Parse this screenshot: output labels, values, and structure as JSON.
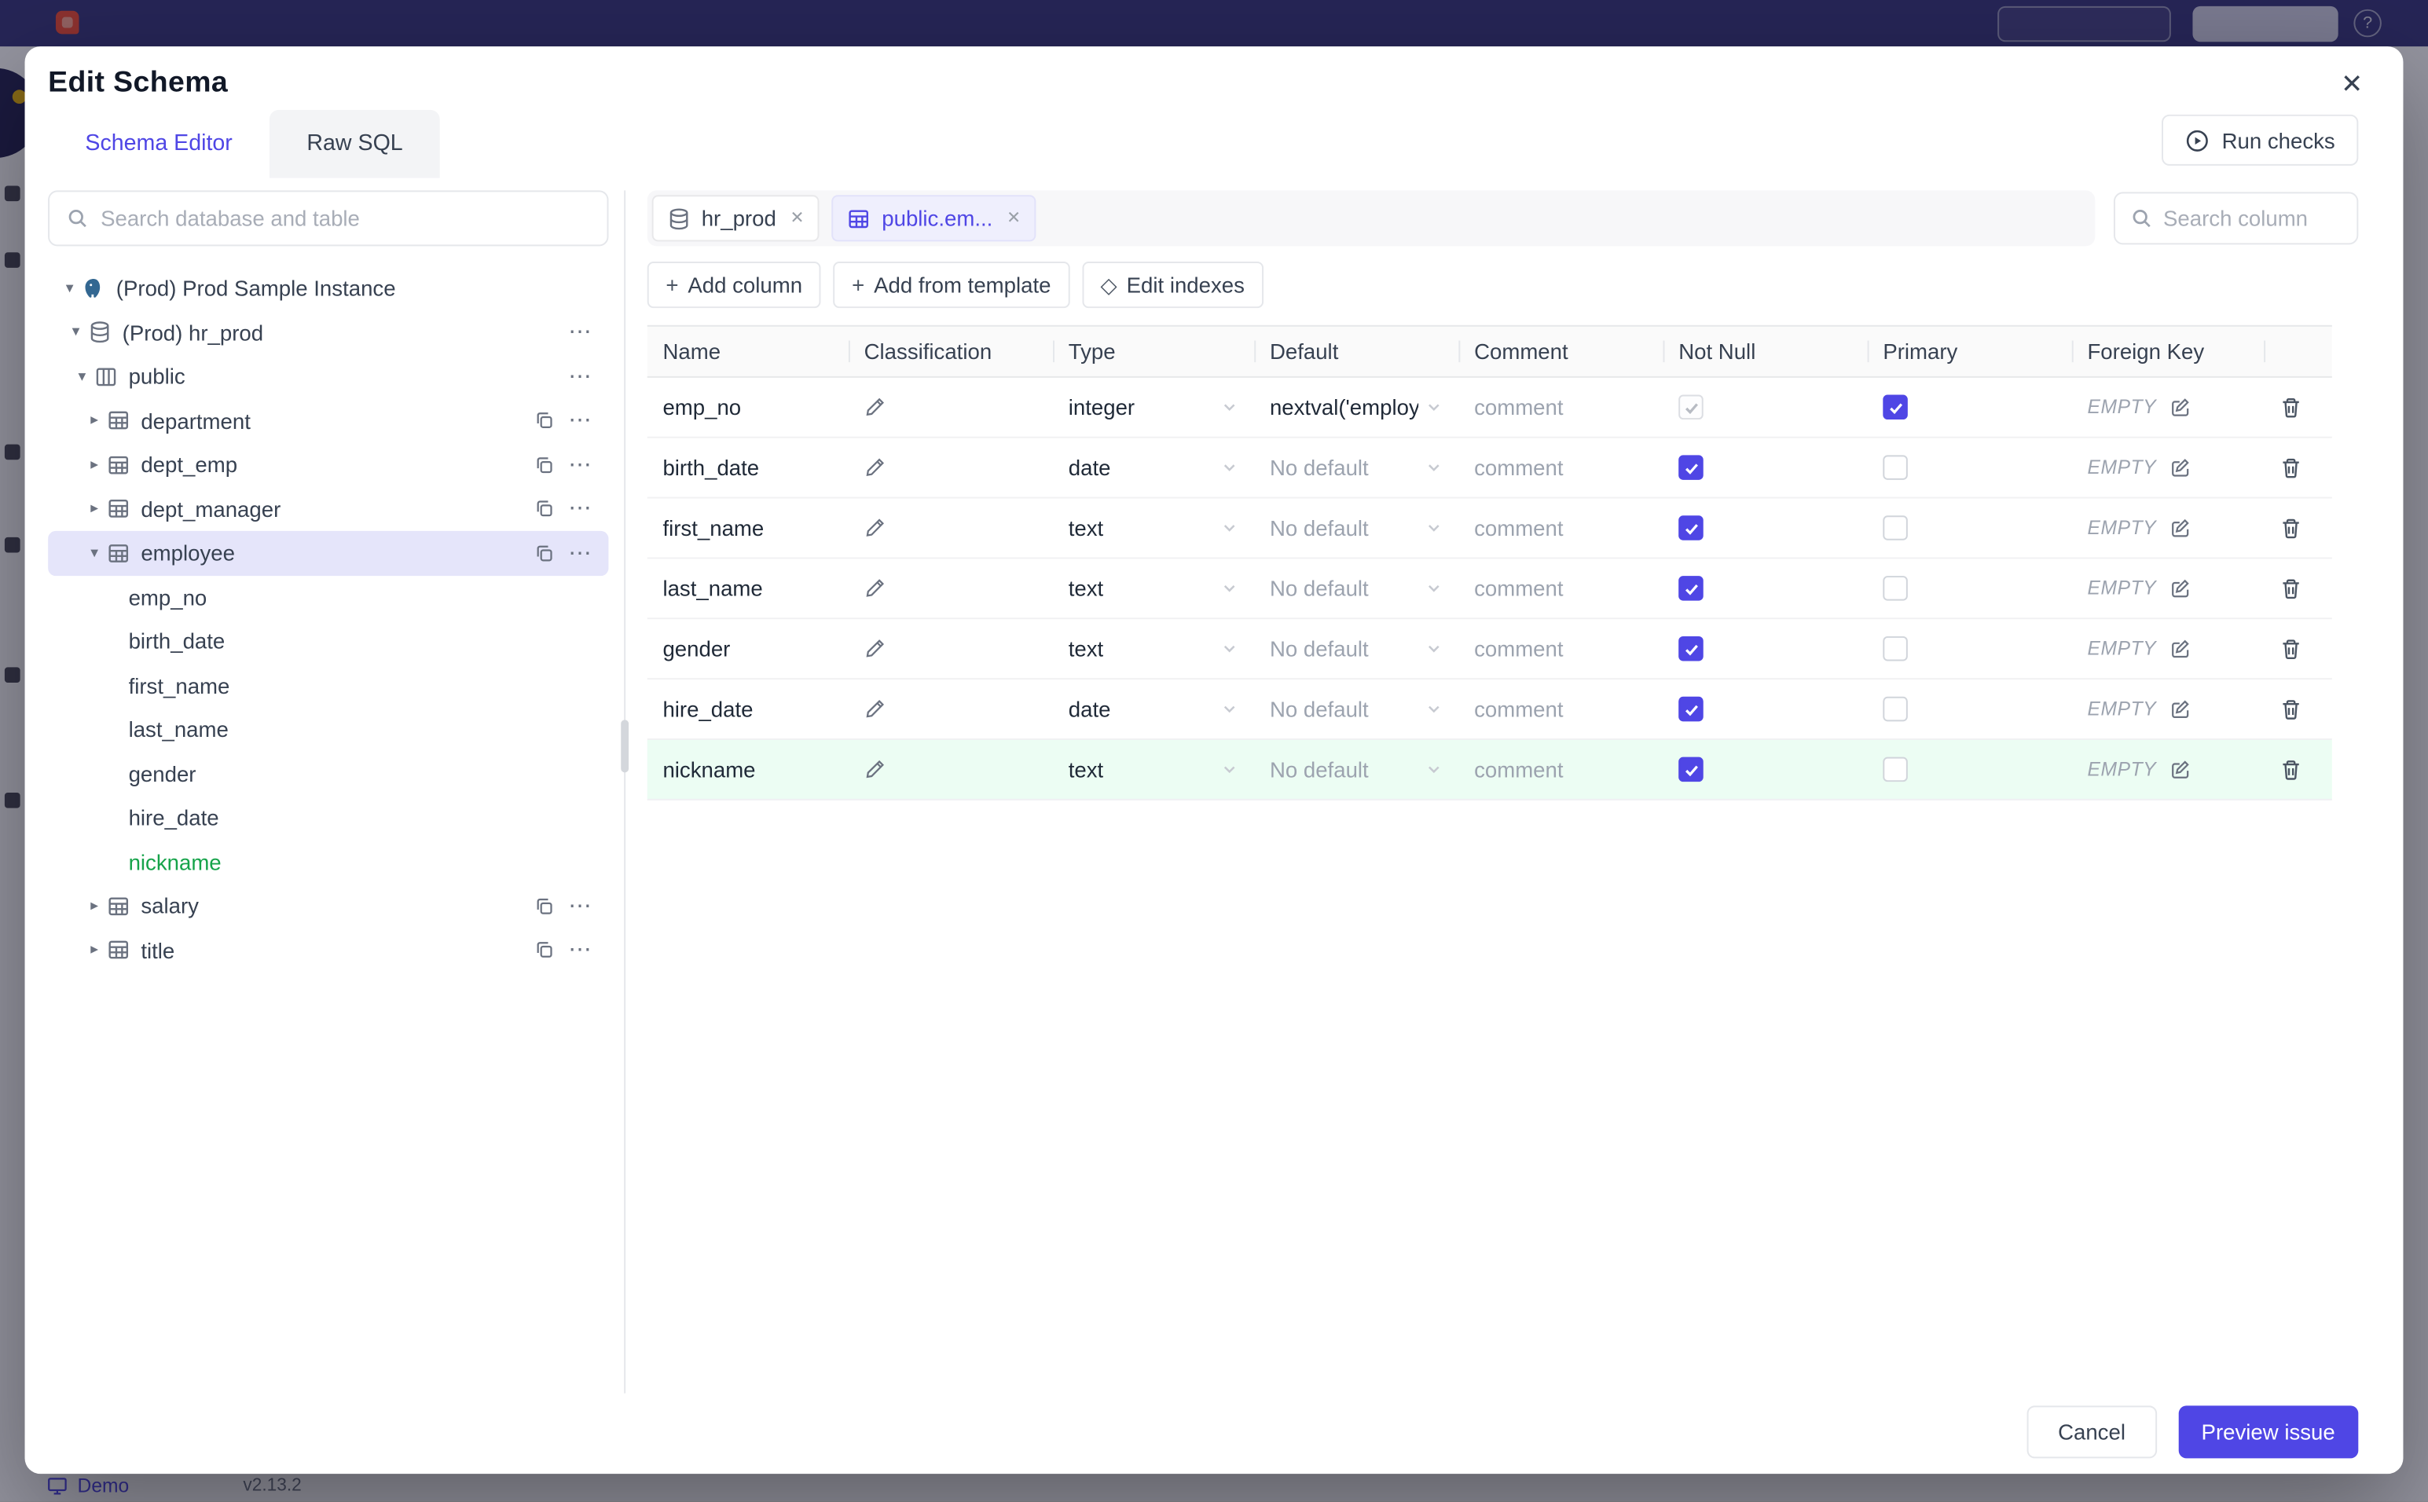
{
  "icons": {
    "close": "✕",
    "plus": "+",
    "diamond": "◇",
    "caret_down": "▾",
    "caret_right": "▸",
    "ellipsis": "⋯",
    "help": "?"
  },
  "colors": {
    "primary": "#4f46e5",
    "green": "#16a34a",
    "selected_bg": "#e5e5fa",
    "row_highlight": "#ecfdf3"
  },
  "page": {
    "status_bar": {
      "demo_label": "Demo",
      "version": "v2.13.2"
    }
  },
  "modal": {
    "title": "Edit Schema",
    "tabs": [
      {
        "label": "Schema Editor",
        "active": true
      },
      {
        "label": "Raw SQL",
        "active": false
      }
    ],
    "run_checks": "Run checks",
    "sidebar": {
      "search_placeholder": "Search database and table",
      "tree": [
        {
          "level": 0,
          "caret": "down",
          "icon": "postgres",
          "label": "(Prod) Prod Sample Instance"
        },
        {
          "level": 1,
          "caret": "down",
          "icon": "database",
          "label": "(Prod) hr_prod",
          "ellipsis": true
        },
        {
          "level": 2,
          "caret": "down",
          "icon": "schema",
          "label": "public",
          "ellipsis": true
        },
        {
          "level": 3,
          "caret": "right",
          "icon": "table",
          "label": "department",
          "copy": true,
          "ellipsis": true
        },
        {
          "level": 3,
          "caret": "right",
          "icon": "table",
          "label": "dept_emp",
          "copy": true,
          "ellipsis": true
        },
        {
          "level": 3,
          "caret": "right",
          "icon": "table",
          "label": "dept_manager",
          "copy": true,
          "ellipsis": true
        },
        {
          "level": 3,
          "caret": "down",
          "icon": "table",
          "label": "employee",
          "copy": true,
          "ellipsis": true,
          "selected": true
        },
        {
          "level": 4,
          "label": "emp_no"
        },
        {
          "level": 4,
          "label": "birth_date"
        },
        {
          "level": 4,
          "label": "first_name"
        },
        {
          "level": 4,
          "label": "last_name"
        },
        {
          "level": 4,
          "label": "gender"
        },
        {
          "level": 4,
          "label": "hire_date"
        },
        {
          "level": 4,
          "label": "nickname",
          "green": true
        },
        {
          "level": 3,
          "caret": "right",
          "icon": "table",
          "label": "salary",
          "copy": true,
          "ellipsis": true
        },
        {
          "level": 3,
          "caret": "right",
          "icon": "table",
          "label": "title",
          "copy": true,
          "ellipsis": true
        }
      ]
    },
    "editor": {
      "chips": [
        {
          "label": "hr_prod",
          "icon": "database",
          "active": false
        },
        {
          "label": "public.em...",
          "icon": "table",
          "active": true
        }
      ],
      "column_search_placeholder": "Search column",
      "toolbar": [
        {
          "icon": "plus",
          "label": "Add column"
        },
        {
          "icon": "plus",
          "label": "Add from template"
        },
        {
          "icon": "diamond",
          "label": "Edit indexes"
        }
      ],
      "table": {
        "headers": [
          "Name",
          "Classification",
          "Type",
          "Default",
          "Comment",
          "Not Null",
          "Primary",
          "Foreign Key"
        ],
        "comment_placeholder": "comment",
        "no_default_label": "No default",
        "fk_empty_label": "EMPTY",
        "rows": [
          {
            "name": "emp_no",
            "type": "integer",
            "default": "nextval('employ",
            "default_muted": false,
            "not_null": true,
            "not_null_disabled": true,
            "primary": true,
            "highlight": false
          },
          {
            "name": "birth_date",
            "type": "date",
            "default": "",
            "default_muted": true,
            "not_null": true,
            "not_null_disabled": false,
            "primary": false,
            "highlight": false
          },
          {
            "name": "first_name",
            "type": "text",
            "default": "",
            "default_muted": true,
            "not_null": true,
            "not_null_disabled": false,
            "primary": false,
            "highlight": false
          },
          {
            "name": "last_name",
            "type": "text",
            "default": "",
            "default_muted": true,
            "not_null": true,
            "not_null_disabled": false,
            "primary": false,
            "highlight": false
          },
          {
            "name": "gender",
            "type": "text",
            "default": "",
            "default_muted": true,
            "not_null": true,
            "not_null_disabled": false,
            "primary": false,
            "highlight": false
          },
          {
            "name": "hire_date",
            "type": "date",
            "default": "",
            "default_muted": true,
            "not_null": true,
            "not_null_disabled": false,
            "primary": false,
            "highlight": false
          },
          {
            "name": "nickname",
            "type": "text",
            "default": "",
            "default_muted": true,
            "not_null": true,
            "not_null_disabled": false,
            "primary": false,
            "highlight": true
          }
        ]
      }
    },
    "footer": {
      "cancel": "Cancel",
      "submit": "Preview issue"
    }
  }
}
